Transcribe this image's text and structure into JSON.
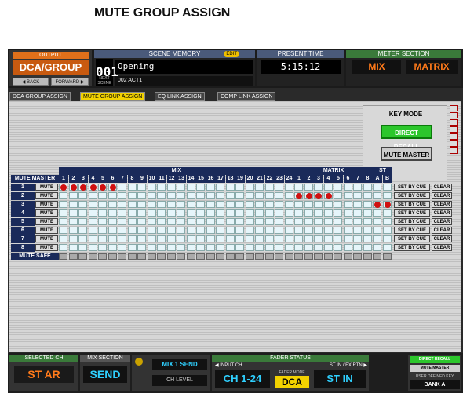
{
  "caption": "MUTE GROUP ASSIGN",
  "topbar": {
    "output_label": "OUTPUT",
    "output_value": "DCA/GROUP",
    "back_label": "◀ BACK",
    "forward_label": "FORWARD ▶",
    "scene_label": "SCENE MEMORY",
    "edit_badge": "EDIT",
    "scene_number": "001",
    "scene_name": "Opening",
    "next_label": "NEXT SCENE",
    "next_value": "002 ACT1",
    "time_label": "PRESENT TIME",
    "time_value": "5:15:12",
    "meter_label": "METER SECTION",
    "meter_mix": "MIX",
    "meter_matrix": "MATRIX"
  },
  "tabs": [
    {
      "label": "DCA GROUP ASSIGN",
      "active": false
    },
    {
      "label": "MUTE GROUP ASSIGN",
      "active": true
    },
    {
      "label": "EQ LINK ASSIGN",
      "active": false
    },
    {
      "label": "COMP LINK ASSIGN",
      "active": false
    }
  ],
  "key_mode": {
    "title": "KEY MODE",
    "direct_recall": "DIRECT RECALL",
    "mute_master": "MUTE MASTER"
  },
  "grid": {
    "mute_master_header": "MUTE MASTER",
    "mix_header": "MIX",
    "matrix_header": "MATRIX",
    "st_header": "ST",
    "mix_cols": [
      "1",
      "2",
      "3",
      "4",
      "5",
      "6",
      "7",
      "8",
      "9",
      "10",
      "11",
      "12",
      "13",
      "14",
      "15",
      "16",
      "17",
      "18",
      "19",
      "20",
      "21",
      "22",
      "23",
      "24"
    ],
    "matrix_cols": [
      "1",
      "2",
      "3",
      "4",
      "5",
      "6",
      "7",
      "8"
    ],
    "st_cols": [
      "A",
      "B"
    ],
    "mute_label": "MUTE",
    "set_by_cue": "SET BY CUE",
    "clear": "CLEAR",
    "mute_safe": "MUTE SAFE",
    "rows": [
      {
        "num": "1",
        "on": [
          0,
          1,
          2,
          3,
          4,
          5
        ]
      },
      {
        "num": "2",
        "on": [
          24,
          25,
          26,
          27
        ]
      },
      {
        "num": "3",
        "on": [
          32,
          33
        ]
      },
      {
        "num": "4",
        "on": []
      },
      {
        "num": "5",
        "on": []
      },
      {
        "num": "6",
        "on": []
      },
      {
        "num": "7",
        "on": []
      },
      {
        "num": "8",
        "on": []
      }
    ]
  },
  "bottombar": {
    "selected_ch_label": "SELECTED CH",
    "selected_ch_value": "ST AR",
    "mix_section_label": "MIX SECTION",
    "mix_section_value": "SEND",
    "mix_send": "MIX 1 SEND",
    "ch_level": "CH LEVEL",
    "input_ch_label": "◀ INPUT CH",
    "fader_status_label": "FADER STATUS",
    "st_in_label": "ST IN / FX RTN ▶",
    "ch_value": "CH 1-24",
    "fader_mode_label": "FADER MODE",
    "fader_mode_value": "DCA",
    "st_in_value": "ST IN",
    "direct_recall": "DIRECT RECALL",
    "mute_master": "MUTE MASTER",
    "user_defined": "USER DEFINED KEY",
    "bank": "BANK A"
  },
  "colors": {
    "accent_orange": "#e0701a",
    "tab_active": "#f3d200",
    "key_on": "#2cc62c",
    "dot_red": "#d01010",
    "header_blue": "#1a2a5a"
  }
}
